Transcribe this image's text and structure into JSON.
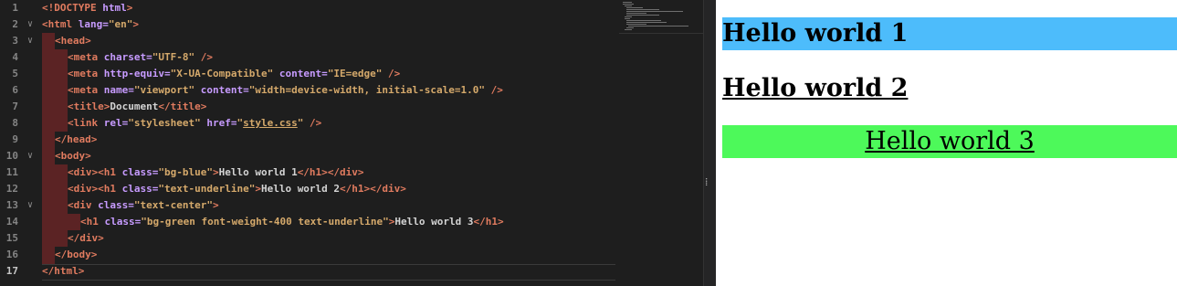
{
  "editor": {
    "line_numbers": [
      "1",
      "2",
      "3",
      "4",
      "5",
      "6",
      "7",
      "8",
      "9",
      "10",
      "11",
      "12",
      "13",
      "14",
      "15",
      "16",
      "17"
    ],
    "lines": {
      "l1": {
        "doctype": "<!DOCTYPE",
        "html": " html",
        "close": ">"
      },
      "l2": {
        "open": "<html",
        "attr": " lang=",
        "val": "\"en\"",
        "close": ">"
      },
      "l3": {
        "open": "<head",
        "close": ">"
      },
      "l4": {
        "open": "<meta",
        "attr": " charset=",
        "val": "\"UTF-8\"",
        "close": " />"
      },
      "l5": {
        "open": "<meta",
        "attr1": " http-equiv=",
        "val1": "\"X-UA-Compatible\"",
        "attr2": " content=",
        "val2": "\"IE=edge\"",
        "close": " />"
      },
      "l6": {
        "open": "<meta",
        "attr1": " name=",
        "val1": "\"viewport\"",
        "attr2": " content=",
        "val2": "\"width=device-width, initial-scale=1.0\"",
        "close": " />"
      },
      "l7": {
        "open": "<title",
        "gt": ">",
        "text": "Document",
        "end": "</title>"
      },
      "l8": {
        "open": "<link",
        "attr1": " rel=",
        "val1": "\"stylesheet\"",
        "attr2": " href=",
        "q1": "\"",
        "file": "style.css",
        "q2": "\"",
        "close": " />"
      },
      "l9": {
        "end": "</head>"
      },
      "l10": {
        "open": "<body",
        "close": ">"
      },
      "l11": {
        "div": "<div>",
        "h1": "<h1",
        "attr": " class=",
        "val": "\"bg-blue\"",
        "gt": ">",
        "text": "Hello world 1",
        "endh1": "</h1>",
        "enddiv": "</div>"
      },
      "l12": {
        "div": "<div>",
        "h1": "<h1",
        "attr": " class=",
        "val": "\"text-underline\"",
        "gt": ">",
        "text": "Hello world 2",
        "endh1": "</h1>",
        "enddiv": "</div>"
      },
      "l13": {
        "open": "<div",
        "attr": " class=",
        "val": "\"text-center\"",
        "close": ">"
      },
      "l14": {
        "h1": "<h1",
        "attr": " class=",
        "val": "\"bg-green font-weight-400 text-underline\"",
        "gt": ">",
        "text": "Hello world 3",
        "endh1": "</h1>"
      },
      "l15": {
        "end": "</div>"
      },
      "l16": {
        "end": "</body>"
      },
      "l17": {
        "end": "</html>"
      }
    },
    "scroll_grip": "⁞"
  },
  "preview": {
    "heading1": "Hello world 1",
    "heading2": "Hello world 2",
    "heading3": "Hello world 3"
  },
  "colors": {
    "bg_blue": "#4dbcfb",
    "bg_green": "#4df95a",
    "editor_bg": "#1e1e1e",
    "tag": "#e07b5f",
    "attr": "#c79bff",
    "string": "#d5a96b"
  }
}
